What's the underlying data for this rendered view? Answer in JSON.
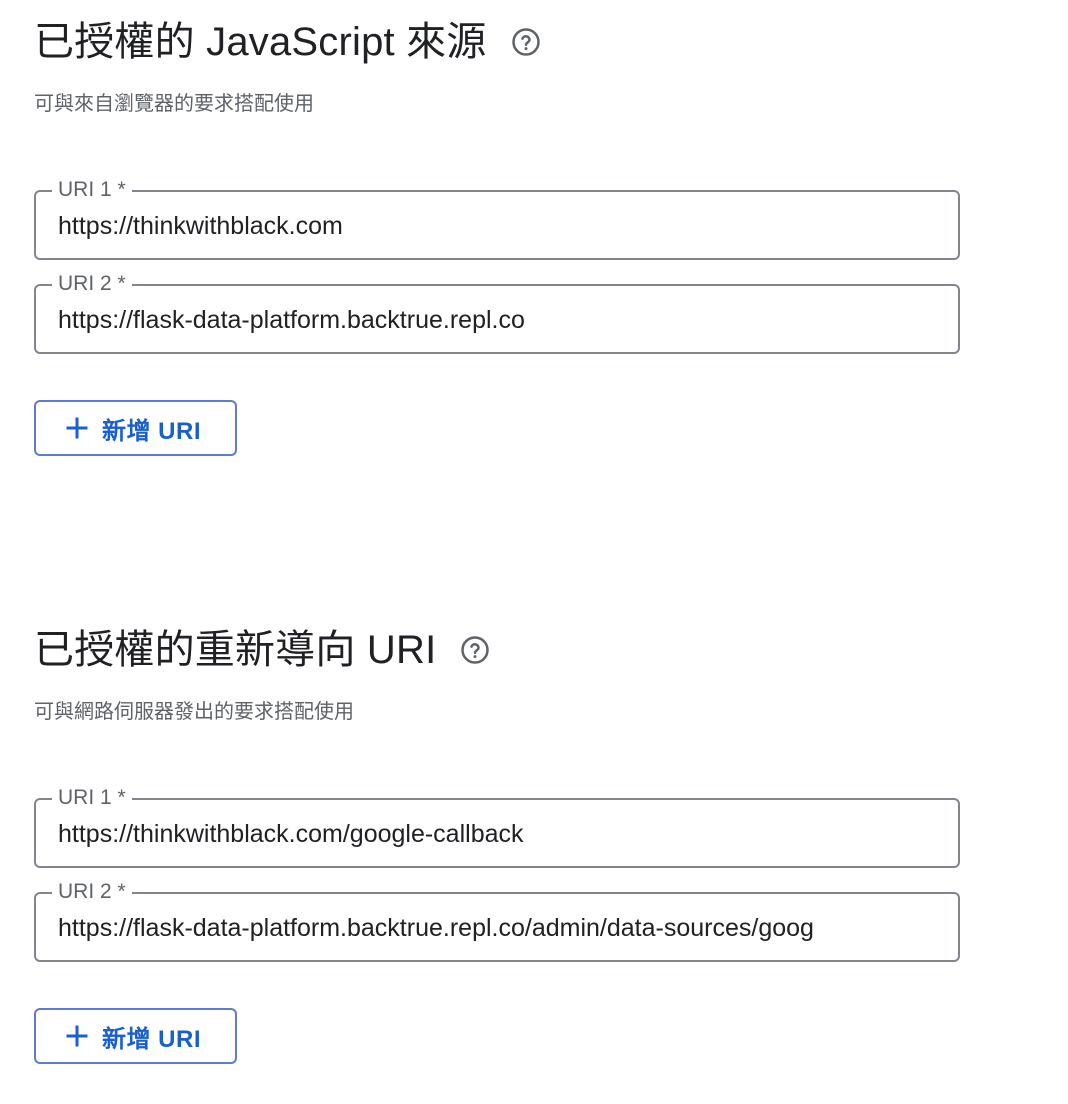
{
  "sections": [
    {
      "title": "已授權的 JavaScript 來源",
      "subtitle": "可與來自瀏覽器的要求搭配使用",
      "fields": [
        {
          "label": "URI 1 *",
          "value": "https://thinkwithblack.com"
        },
        {
          "label": "URI 2 *",
          "value": "https://flask-data-platform.backtrue.repl.co"
        }
      ],
      "add_button_label": "新增 URI"
    },
    {
      "title": "已授權的重新導向 URI",
      "subtitle": "可與網路伺服器發出的要求搭配使用",
      "fields": [
        {
          "label": "URI 1 *",
          "value": "https://thinkwithblack.com/google-callback"
        },
        {
          "label": "URI 2 *",
          "value": "https://flask-data-platform.backtrue.repl.co/admin/data-sources/goog"
        }
      ],
      "add_button_label": "新增 URI"
    }
  ],
  "icons": {
    "help": "help-circle-icon",
    "add": "plus-icon"
  },
  "colors": {
    "accent": "#1a5fd0",
    "button_border": "#5f7bd0",
    "field_border": "#80868b",
    "label_text": "#5f6368"
  }
}
